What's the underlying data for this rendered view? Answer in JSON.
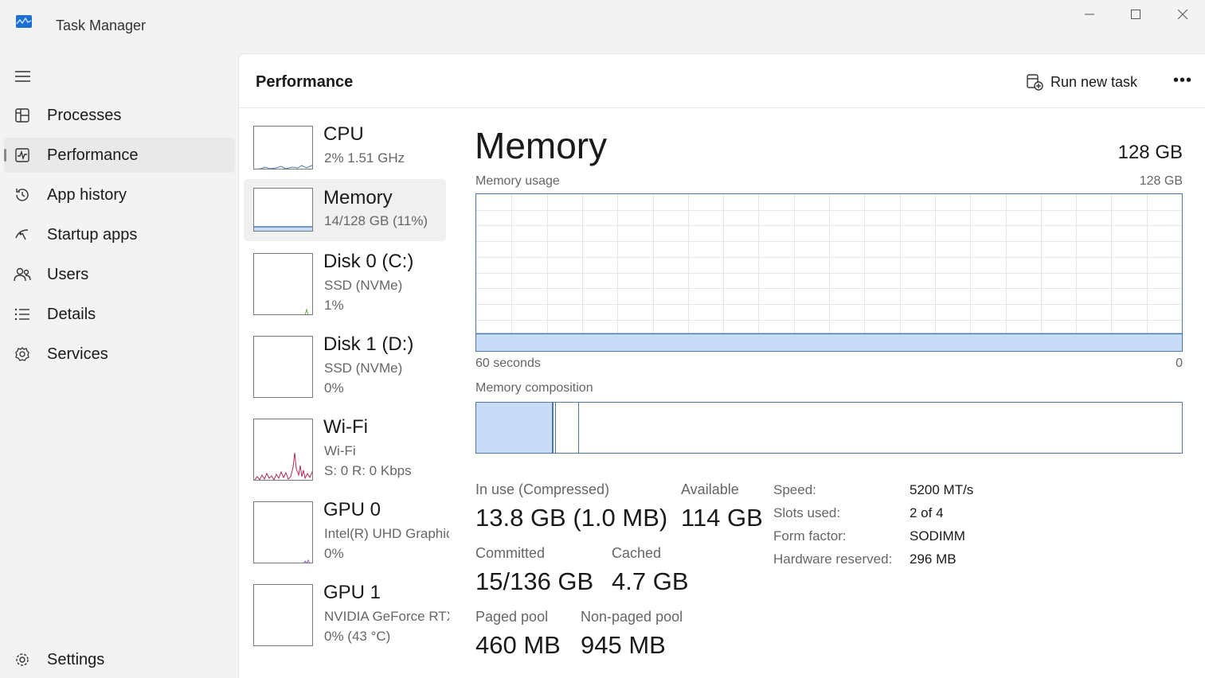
{
  "window": {
    "title": "Task Manager"
  },
  "sidebar": {
    "items": [
      {
        "label": "Processes",
        "icon": "processes-icon"
      },
      {
        "label": "Performance",
        "icon": "performance-icon",
        "active": true
      },
      {
        "label": "App history",
        "icon": "history-icon"
      },
      {
        "label": "Startup apps",
        "icon": "startup-icon"
      },
      {
        "label": "Users",
        "icon": "users-icon"
      },
      {
        "label": "Details",
        "icon": "details-icon"
      },
      {
        "label": "Services",
        "icon": "services-icon"
      }
    ],
    "settings": "Settings"
  },
  "header": {
    "title": "Performance",
    "run_new_task": "Run new task"
  },
  "devices": [
    {
      "name": "CPU",
      "sub1": "2% 1.51 GHz"
    },
    {
      "name": "Memory",
      "sub1": "14/128 GB (11%)",
      "active": true
    },
    {
      "name": "Disk 0 (C:)",
      "sub1": "SSD (NVMe)",
      "sub2": "1%"
    },
    {
      "name": "Disk 1 (D:)",
      "sub1": "SSD (NVMe)",
      "sub2": "0%"
    },
    {
      "name": "Wi-Fi",
      "sub1": "Wi-Fi",
      "sub2": "S: 0 R: 0 Kbps"
    },
    {
      "name": "GPU 0",
      "sub1": "Intel(R) UHD Graphics",
      "sub2": "0%"
    },
    {
      "name": "GPU 1",
      "sub1": "NVIDIA GeForce RTX",
      "sub2": "0% (43 °C)"
    }
  ],
  "memory": {
    "title": "Memory",
    "total": "128 GB",
    "usage_label": "Memory usage",
    "usage_max": "128 GB",
    "time_left": "60 seconds",
    "time_right": "0",
    "composition_label": "Memory composition",
    "usage_fraction": 0.11,
    "stats": {
      "in_use_label": "In use (Compressed)",
      "in_use_value": "13.8 GB (1.0 MB)",
      "available_label": "Available",
      "available_value": "114 GB",
      "committed_label": "Committed",
      "committed_value": "15/136 GB",
      "cached_label": "Cached",
      "cached_value": "4.7 GB",
      "paged_label": "Paged pool",
      "paged_value": "460 MB",
      "nonpaged_label": "Non-paged pool",
      "nonpaged_value": "945 MB"
    },
    "specs": [
      {
        "k": "Speed:",
        "v": "5200 MT/s"
      },
      {
        "k": "Slots used:",
        "v": "2 of 4"
      },
      {
        "k": "Form factor:",
        "v": "SODIMM"
      },
      {
        "k": "Hardware reserved:",
        "v": "296 MB"
      }
    ]
  },
  "colors": {
    "memory_line": "#4a79b0",
    "memory_fill": "#c9dcf7",
    "cpu": "#4a79b0",
    "disk": "#6aa84f",
    "wifi": "#b0285d",
    "gpu": "#8b5cc2"
  }
}
